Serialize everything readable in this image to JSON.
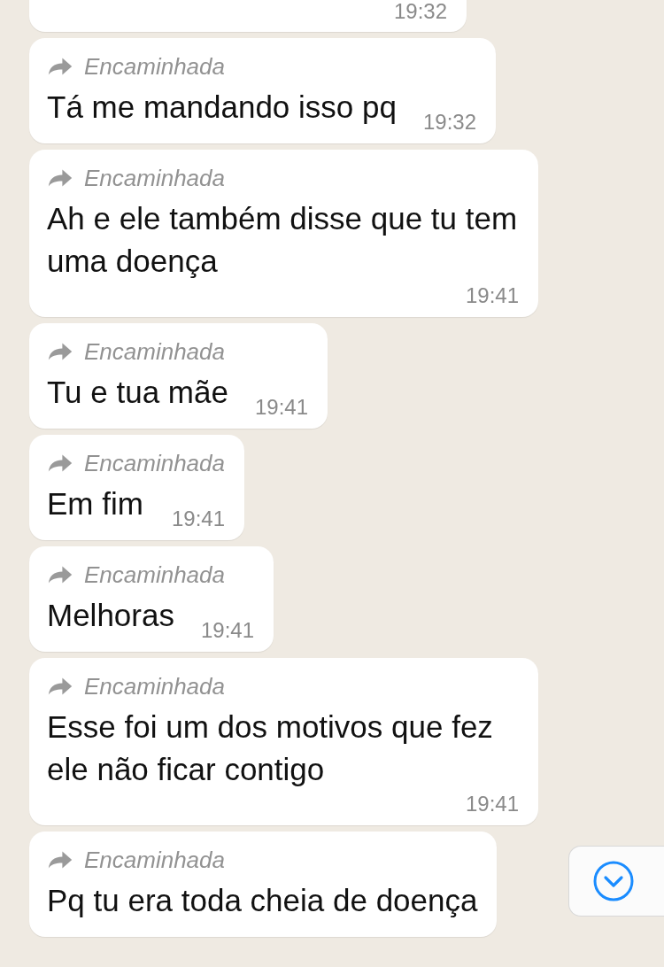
{
  "messages": [
    {
      "time": "19:32"
    },
    {
      "forwarded_label": "Encaminhada",
      "text": "Tá me mandando isso pq",
      "time": "19:32"
    },
    {
      "forwarded_label": "Encaminhada",
      "text": "Ah e ele também disse que tu tem uma doença",
      "time": "19:41"
    },
    {
      "forwarded_label": "Encaminhada",
      "text": "Tu e tua mãe",
      "time": "19:41"
    },
    {
      "forwarded_label": "Encaminhada",
      "text": "Em fim",
      "time": "19:41"
    },
    {
      "forwarded_label": "Encaminhada",
      "text": "Melhoras",
      "time": "19:41"
    },
    {
      "forwarded_label": "Encaminhada",
      "text": "Esse foi um dos motivos que fez ele não ficar contigo",
      "time": "19:41"
    },
    {
      "forwarded_label": "Encaminhada",
      "text": "Pq tu era toda cheia de doença"
    }
  ]
}
